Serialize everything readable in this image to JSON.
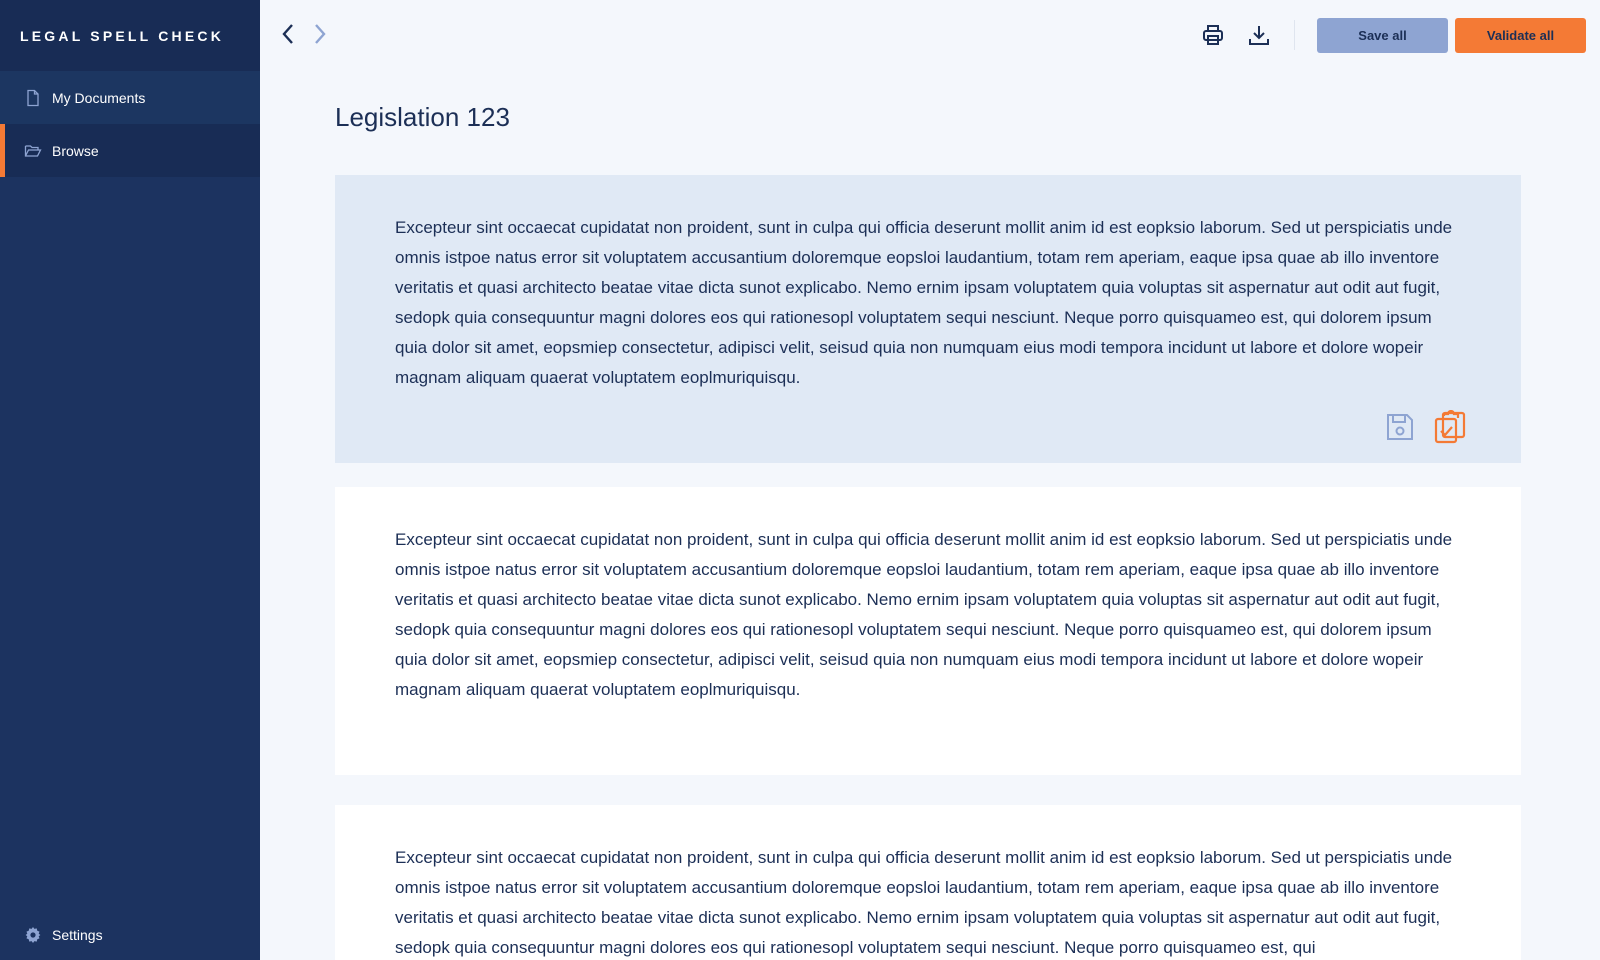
{
  "app": {
    "brand": "LEGAL SPELL CHECK"
  },
  "sidebar": {
    "items": [
      {
        "label": "My Documents",
        "icon": "document-icon"
      },
      {
        "label": "Browse",
        "icon": "folder-open-icon"
      }
    ],
    "settings_label": "Settings"
  },
  "toolbar": {
    "save_label": "Save all",
    "validate_label": "Validate all"
  },
  "document": {
    "title": "Legislation 123",
    "paragraphs": [
      {
        "text": "Excepteur sint occaecat cupidatat non proident, sunt in culpa qui officia deserunt mollit anim id est eopksio laborum. Sed ut perspiciatis unde omnis istpoe natus error sit voluptatem accusantium doloremque eopsloi laudantium, totam rem aperiam, eaque ipsa quae ab illo inventore veritatis et quasi architecto beatae vitae dicta sunot explicabo. Nemo ernim ipsam voluptatem quia voluptas sit aspernatur aut odit aut fugit, sedopk quia consequuntur magni dolores eos qui rationesopl voluptatem sequi nesciunt. Neque porro quisquameo est, qui dolorem ipsum quia dolor sit amet, eopsmiep consectetur, adipisci velit, seisud quia non numquam eius modi tempora incidunt ut labore et dolore wopeir magnam aliquam quaerat voluptatem eoplmuriquisqu."
      },
      {
        "text": "Excepteur sint occaecat cupidatat non proident, sunt in culpa qui officia deserunt mollit anim id est eopksio laborum. Sed ut perspiciatis unde omnis istpoe natus error sit voluptatem accusantium doloremque eopsloi laudantium, totam rem aperiam, eaque ipsa quae ab illo inventore veritatis et quasi architecto beatae vitae dicta sunot explicabo. Nemo ernim ipsam voluptatem quia voluptas sit aspernatur aut odit aut fugit, sedopk quia consequuntur magni dolores eos qui rationesopl voluptatem sequi nesciunt. Neque porro quisquameo est, qui dolorem ipsum quia dolor sit amet, eopsmiep consectetur, adipisci velit, seisud quia non numquam eius modi tempora incidunt ut labore et dolore wopeir magnam aliquam quaerat voluptatem eoplmuriquisqu."
      },
      {
        "text": "Excepteur sint occaecat cupidatat non proident, sunt in culpa qui officia deserunt mollit anim id est eopksio laborum. Sed ut perspiciatis unde omnis istpoe natus error sit voluptatem accusantium doloremque eopsloi laudantium, totam rem aperiam, eaque ipsa quae ab illo inventore veritatis et quasi architecto beatae vitae dicta sunot explicabo. Nemo ernim ipsam voluptatem quia voluptas sit aspernatur aut odit aut fugit, sedopk quia consequuntur magni dolores eos qui rationesopl voluptatem sequi nesciunt. Neque porro quisquameo est, qui"
      }
    ]
  },
  "colors": {
    "sidebar_bg": "#1c3360",
    "accent_orange": "#f47a35",
    "save_button": "#8ea4d2",
    "selected_paragraph_bg": "#e0e9f5",
    "text": "#1c2f56"
  }
}
